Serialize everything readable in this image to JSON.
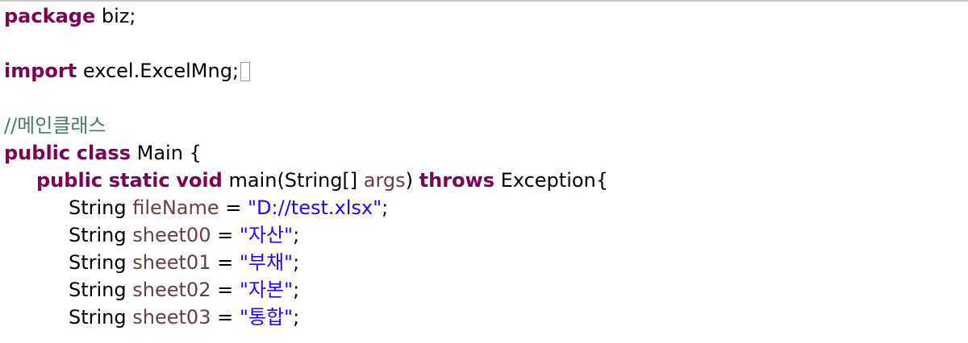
{
  "colors": {
    "keyword": "#7f0055",
    "variable": "#6a3e3e",
    "string": "#2a00ff",
    "comment": "#3f7f5f",
    "text": "#000000"
  },
  "lines": [
    {
      "indent": 0,
      "tokens": [
        {
          "t": "package",
          "c": "kw"
        },
        {
          "t": " biz;",
          "c": ""
        }
      ]
    },
    {
      "indent": 0,
      "tokens": []
    },
    {
      "indent": 0,
      "tokens": [
        {
          "t": "import",
          "c": "kw"
        },
        {
          "t": " excel.ExcelMng;",
          "c": ""
        }
      ],
      "folded": true
    },
    {
      "indent": 0,
      "tokens": []
    },
    {
      "indent": 0,
      "tokens": [
        {
          "t": "//메인클래스",
          "c": "cmt"
        }
      ]
    },
    {
      "indent": 0,
      "tokens": [
        {
          "t": "public",
          "c": "kw"
        },
        {
          "t": " ",
          "c": ""
        },
        {
          "t": "class",
          "c": "kw"
        },
        {
          "t": " Main {",
          "c": ""
        }
      ]
    },
    {
      "indent": 1,
      "tokens": [
        {
          "t": "public",
          "c": "kw"
        },
        {
          "t": " ",
          "c": ""
        },
        {
          "t": "static",
          "c": "kw"
        },
        {
          "t": " ",
          "c": ""
        },
        {
          "t": "void",
          "c": "kw"
        },
        {
          "t": " main(String[] ",
          "c": ""
        },
        {
          "t": "args",
          "c": "var"
        },
        {
          "t": ") ",
          "c": ""
        },
        {
          "t": "throws",
          "c": "kw"
        },
        {
          "t": " Exception{",
          "c": ""
        }
      ]
    },
    {
      "indent": 2,
      "tokens": [
        {
          "t": "String ",
          "c": ""
        },
        {
          "t": "fileName",
          "c": "var"
        },
        {
          "t": " = ",
          "c": ""
        },
        {
          "t": "\"D://test.xlsx\"",
          "c": "str"
        },
        {
          "t": ";",
          "c": ""
        }
      ]
    },
    {
      "indent": 2,
      "tokens": [
        {
          "t": "String ",
          "c": ""
        },
        {
          "t": "sheet00",
          "c": "var"
        },
        {
          "t": " = ",
          "c": ""
        },
        {
          "t": "\"자산\"",
          "c": "str"
        },
        {
          "t": ";",
          "c": ""
        }
      ]
    },
    {
      "indent": 2,
      "tokens": [
        {
          "t": "String ",
          "c": ""
        },
        {
          "t": "sheet01",
          "c": "var"
        },
        {
          "t": " = ",
          "c": ""
        },
        {
          "t": "\"부채\"",
          "c": "str"
        },
        {
          "t": ";",
          "c": ""
        }
      ]
    },
    {
      "indent": 2,
      "tokens": [
        {
          "t": "String ",
          "c": ""
        },
        {
          "t": "sheet02",
          "c": "var"
        },
        {
          "t": " = ",
          "c": ""
        },
        {
          "t": "\"자본\"",
          "c": "str"
        },
        {
          "t": ";",
          "c": ""
        }
      ]
    },
    {
      "indent": 2,
      "tokens": [
        {
          "t": "String ",
          "c": ""
        },
        {
          "t": "sheet03",
          "c": "var"
        },
        {
          "t": " = ",
          "c": ""
        },
        {
          "t": "\"통합\"",
          "c": "str"
        },
        {
          "t": ";",
          "c": ""
        }
      ]
    }
  ]
}
